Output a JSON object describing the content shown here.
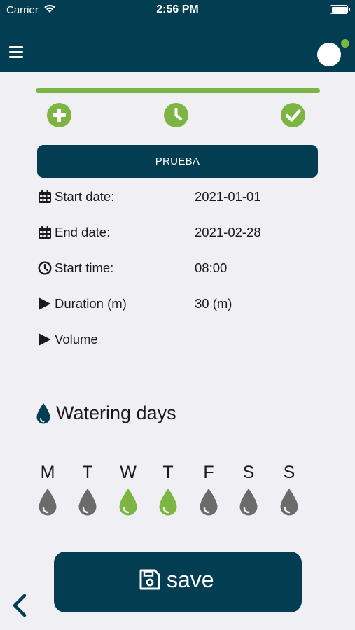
{
  "status_bar": {
    "carrier": "Carrier",
    "time": "2:56 PM"
  },
  "header": {
    "menu_icon": "hamburger-menu-icon",
    "avatar_status_color": "#7db543"
  },
  "steps": [
    {
      "icon": "plus-circle-icon"
    },
    {
      "icon": "clock-icon"
    },
    {
      "icon": "check-icon"
    }
  ],
  "program": {
    "title": "PRUEBA"
  },
  "details": [
    {
      "icon": "calendar-icon",
      "label": "Start date:",
      "value": "2021-01-01"
    },
    {
      "icon": "calendar-icon",
      "label": "End date:",
      "value": "2021-02-28"
    },
    {
      "icon": "clock-icon",
      "label": "Start time:",
      "value": "08:00"
    },
    {
      "icon": "play-icon",
      "label": "Duration (m)",
      "value": "30 (m)"
    },
    {
      "icon": "play-icon",
      "label": "Volume",
      "value": ""
    }
  ],
  "watering_days": {
    "title": "Watering days",
    "icon": "water-drop-icon",
    "days": [
      {
        "letter": "M",
        "active": false
      },
      {
        "letter": "T",
        "active": false
      },
      {
        "letter": "W",
        "active": true
      },
      {
        "letter": "T",
        "active": true
      },
      {
        "letter": "F",
        "active": false
      },
      {
        "letter": "S",
        "active": false
      },
      {
        "letter": "S",
        "active": false
      }
    ]
  },
  "actions": {
    "save_label": "save",
    "back_icon": "chevron-left-icon"
  },
  "colors": {
    "primary": "#033d52",
    "accent": "#7db543",
    "inactive": "#6b6b6b",
    "background": "#efeff4"
  }
}
